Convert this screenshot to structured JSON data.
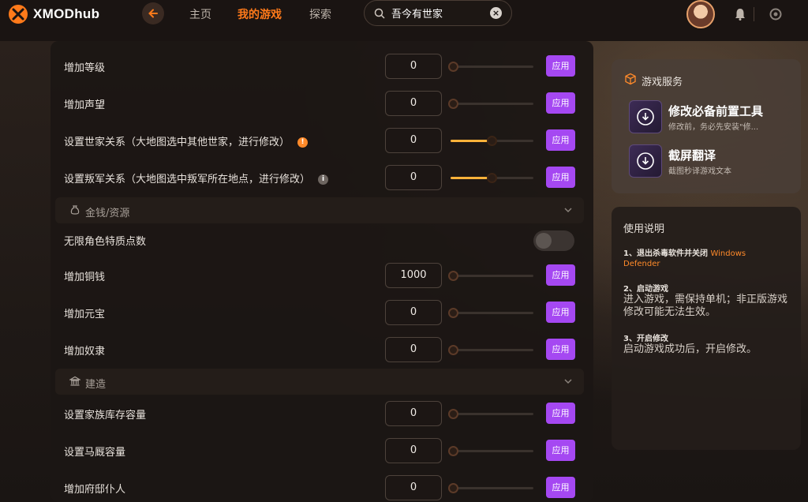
{
  "app": {
    "logo_text": "XMODhub"
  },
  "nav": {
    "tabs": [
      {
        "label": "主页"
      },
      {
        "label": "我的游戏"
      },
      {
        "label": "探索"
      }
    ],
    "search_value": "吾今有世家"
  },
  "colors": {
    "accent": "#ff7a1a",
    "apply": "#a548f2",
    "slider_fill": "#ffb23a"
  },
  "rows_top": [
    {
      "label": "增加等级",
      "value": "0",
      "slider": 0.0,
      "apply": "应用"
    },
    {
      "label": "增加声望",
      "value": "0",
      "slider": 0.0,
      "apply": "应用"
    },
    {
      "label": "设置世家关系（大地图选中其他世家，进行修改）",
      "value": "0",
      "slider": 0.5,
      "apply": "应用",
      "info": "orange"
    },
    {
      "label": "设置叛军关系（大地图选中叛军所在地点，进行修改）",
      "value": "0",
      "slider": 0.5,
      "apply": "应用",
      "info": "grey"
    }
  ],
  "section_money": {
    "label": "金钱/资源",
    "toggle_row": {
      "label": "无限角色特质点数",
      "on": false
    },
    "rows": [
      {
        "label": "增加铜钱",
        "value": "1000",
        "slider": 0.0,
        "apply": "应用"
      },
      {
        "label": "增加元宝",
        "value": "0",
        "slider": 0.0,
        "apply": "应用"
      },
      {
        "label": "增加奴隶",
        "value": "0",
        "slider": 0.0,
        "apply": "应用"
      }
    ]
  },
  "section_build": {
    "label": "建造",
    "rows": [
      {
        "label": "设置家族库存容量",
        "value": "0",
        "slider": 0.0,
        "apply": "应用"
      },
      {
        "label": "设置马厩容量",
        "value": "0",
        "slider": 0.0,
        "apply": "应用"
      },
      {
        "label": "增加府邸仆人",
        "value": "0",
        "slider": 0.0,
        "apply": "应用"
      }
    ]
  },
  "services": {
    "title": "游戏服务",
    "items": [
      {
        "name": "修改必备前置工具",
        "desc": "修改前，务必先安装\"修..."
      },
      {
        "name": "截屏翻译",
        "desc": "截图秒译游戏文本"
      }
    ]
  },
  "help": {
    "title": "使用说明",
    "steps": [
      {
        "head": "1、退出杀毒软件并关闭",
        "highlight": "Windows",
        "highlight2": "Defender",
        "body": ""
      },
      {
        "head": "2、启动游戏",
        "body": "进入游戏，需保持单机；非正版游戏修改可能无法生效。"
      },
      {
        "head": "3、开启修改",
        "body": "启动游戏成功后，开启修改。"
      }
    ]
  }
}
